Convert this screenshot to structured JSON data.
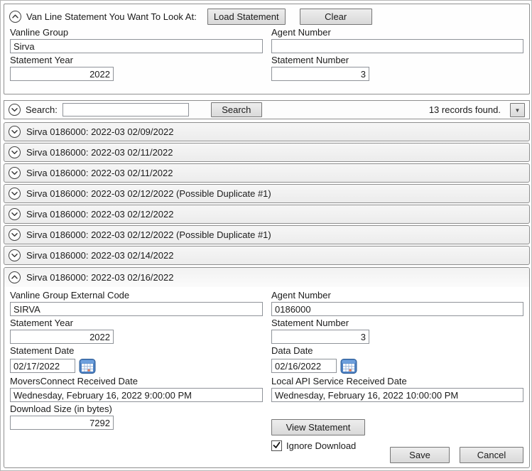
{
  "colors": {
    "panel_border": "#8f8f8f",
    "row_background": "#f0f0f0",
    "button_background": "#dcdcdc",
    "calendar_blue": "#4e82c4",
    "calendar_highlight_orange": "#e8734a",
    "text": "#1b1b1b"
  },
  "top_group": {
    "title": "Van Line Statement You Want To Look At:",
    "load_statement_button": "Load Statement",
    "clear_button": "Clear",
    "vanline_group_label": "Vanline Group",
    "vanline_group_value": "Sirva",
    "agent_number_label": "Agent Number",
    "agent_number_value": "",
    "statement_year_label": "Statement Year",
    "statement_year_value": "2022",
    "statement_number_label": "Statement Number",
    "statement_number_value": "3"
  },
  "search_bar": {
    "label": "Search:",
    "input_value": "",
    "search_button": "Search",
    "records_found": "13 records found.",
    "dropdown_glyph": "▼"
  },
  "rows": [
    {
      "title": "Sirva 0186000: 2022-03 02/09/2022"
    },
    {
      "title": "Sirva 0186000: 2022-03 02/11/2022"
    },
    {
      "title": "Sirva 0186000: 2022-03 02/11/2022"
    },
    {
      "title": "Sirva 0186000: 2022-03 02/12/2022 (Possible Duplicate #1)"
    },
    {
      "title": "Sirva 0186000: 2022-03 02/12/2022"
    },
    {
      "title": "Sirva 0186000: 2022-03 02/12/2022 (Possible Duplicate #1)"
    },
    {
      "title": "Sirva 0186000: 2022-03 02/14/2022"
    }
  ],
  "expanded_row": {
    "title": "Sirva 0186000: 2022-03 02/16/2022",
    "vanline_group_external_code_label": "Vanline Group External Code",
    "vanline_group_external_code_value": "SIRVA",
    "agent_number_label": "Agent Number",
    "agent_number_value": "0186000",
    "statement_year_label": "Statement Year",
    "statement_year_value": "2022",
    "statement_number_label": "Statement Number",
    "statement_number_value": "3",
    "statement_date_label": "Statement Date",
    "statement_date_value": "02/17/2022",
    "data_date_label": "Data Date",
    "data_date_value": "02/16/2022",
    "moversconnect_received_date_label": "MoversConnect Received Date",
    "moversconnect_received_date_value": "Wednesday, February 16, 2022 9:00:00 PM",
    "local_api_service_received_date_label": "Local API Service Received Date",
    "local_api_service_received_date_value": "Wednesday, February 16, 2022 10:00:00 PM",
    "download_size_label": "Download Size (in bytes)",
    "download_size_value": "7292",
    "view_statement_button": "View Statement",
    "ignore_download_label": "Ignore Download",
    "ignore_download_checked": true,
    "save_button": "Save",
    "cancel_button": "Cancel"
  }
}
